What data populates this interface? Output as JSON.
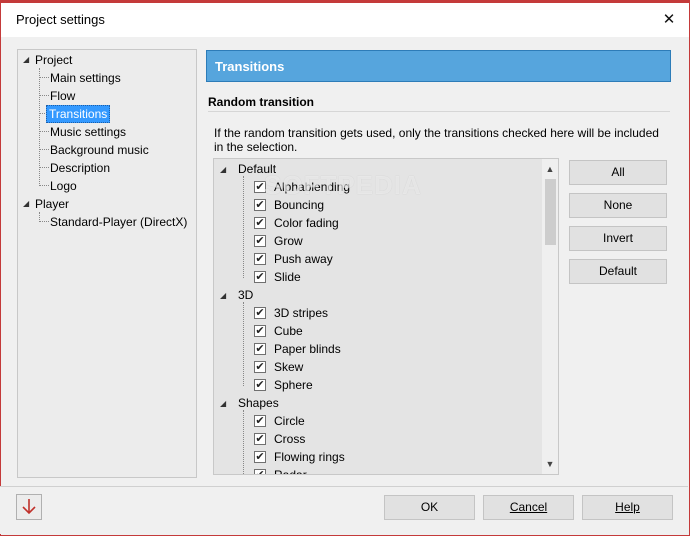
{
  "window": {
    "title": "Project settings",
    "close_glyph": "✕"
  },
  "tree": {
    "project": "Project",
    "items": [
      "Main settings",
      "Flow",
      "Transitions",
      "Music settings",
      "Background music",
      "Description",
      "Logo"
    ],
    "player": "Player",
    "player_items": [
      "Standard-Player (DirectX)"
    ]
  },
  "header": {
    "title": "Transitions"
  },
  "section": {
    "title": "Random transition",
    "description": "If the random transition gets used, only the transitions checked here will be included in the selection."
  },
  "transitions": {
    "groups": [
      {
        "name": "Default",
        "items": [
          "Alphablending",
          "Bouncing",
          "Color fading",
          "Grow",
          "Push away",
          "Slide"
        ]
      },
      {
        "name": "3D",
        "items": [
          "3D stripes",
          "Cube",
          "Paper blinds",
          "Skew",
          "Sphere"
        ]
      },
      {
        "name": "Shapes",
        "items": [
          "Circle",
          "Cross",
          "Flowing rings",
          "Radar"
        ]
      }
    ],
    "checked": true
  },
  "buttons": {
    "all": "All",
    "none": "None",
    "invert": "Invert",
    "default": "Default"
  },
  "footer": {
    "ok": "OK",
    "cancel": "Cancel",
    "help": "Help"
  },
  "watermark": "SOFTPEDIA",
  "colors": {
    "accent": "#56a5dd",
    "selected": "#3399ff",
    "window_border": "#c43a3a",
    "arrow": "#c0302a"
  }
}
